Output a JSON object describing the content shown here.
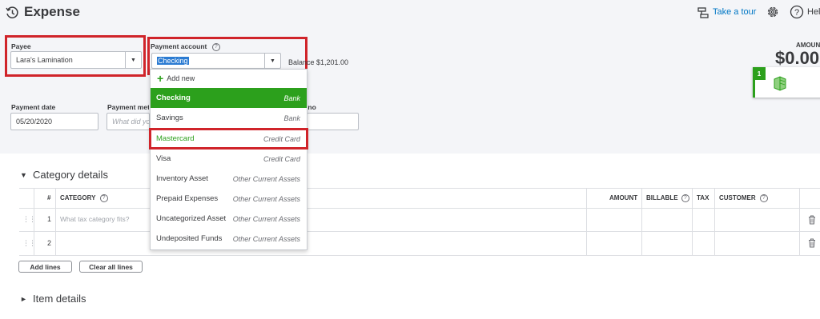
{
  "header": {
    "title": "Expense",
    "tour_label": "Take a tour",
    "help_label": "Help"
  },
  "form": {
    "payee": {
      "label": "Payee",
      "value": "Lara's Lamination"
    },
    "payment_account": {
      "label": "Payment account",
      "value": "Checking",
      "balance": "Balance $1,201.00"
    },
    "payment_date": {
      "label": "Payment date",
      "value": "05/20/2020"
    },
    "payment_method": {
      "label": "Payment method",
      "placeholder": "What did you pay with?"
    },
    "ref_no": {
      "label": "Ref no.",
      "value": ""
    },
    "amount": {
      "label": "AMOUNT",
      "value": "$0.00"
    },
    "receipt_tab_label": "1"
  },
  "dropdown": {
    "add_new": "Add new",
    "items": [
      {
        "name": "Checking",
        "type": "Bank"
      },
      {
        "name": "Savings",
        "type": "Bank"
      },
      {
        "name": "Mastercard",
        "type": "Credit Card"
      },
      {
        "name": "Visa",
        "type": "Credit Card"
      },
      {
        "name": "Inventory Asset",
        "type": "Other Current Assets"
      },
      {
        "name": "Prepaid Expenses",
        "type": "Other Current Assets"
      },
      {
        "name": "Uncategorized Asset",
        "type": "Other Current Assets"
      },
      {
        "name": "Undeposited Funds",
        "type": "Other Current Assets"
      }
    ]
  },
  "category_details": {
    "title": "Category details",
    "columns": {
      "num": "#",
      "category": "CATEGORY",
      "amount": "AMOUNT",
      "billable": "BILLABLE",
      "tax": "TAX",
      "customer": "CUSTOMER"
    },
    "rows": [
      {
        "num": "1",
        "category_placeholder": "What tax category fits?"
      },
      {
        "num": "2",
        "category_placeholder": ""
      }
    ],
    "add_lines": "Add lines",
    "clear_all_lines": "Clear all lines"
  },
  "item_details": {
    "title": "Item details"
  },
  "colors": {
    "brand_green": "#2ca01c",
    "highlight_red": "#d0242a",
    "link_blue": "#0077c5",
    "selection_blue": "#2b7bd2"
  },
  "icons": [
    "history-icon",
    "tour-icon",
    "gear-icon",
    "help-icon",
    "receipt-icon",
    "trash-icon",
    "info-icon",
    "grip-icon",
    "plus-icon",
    "chevron-down-icon"
  ]
}
